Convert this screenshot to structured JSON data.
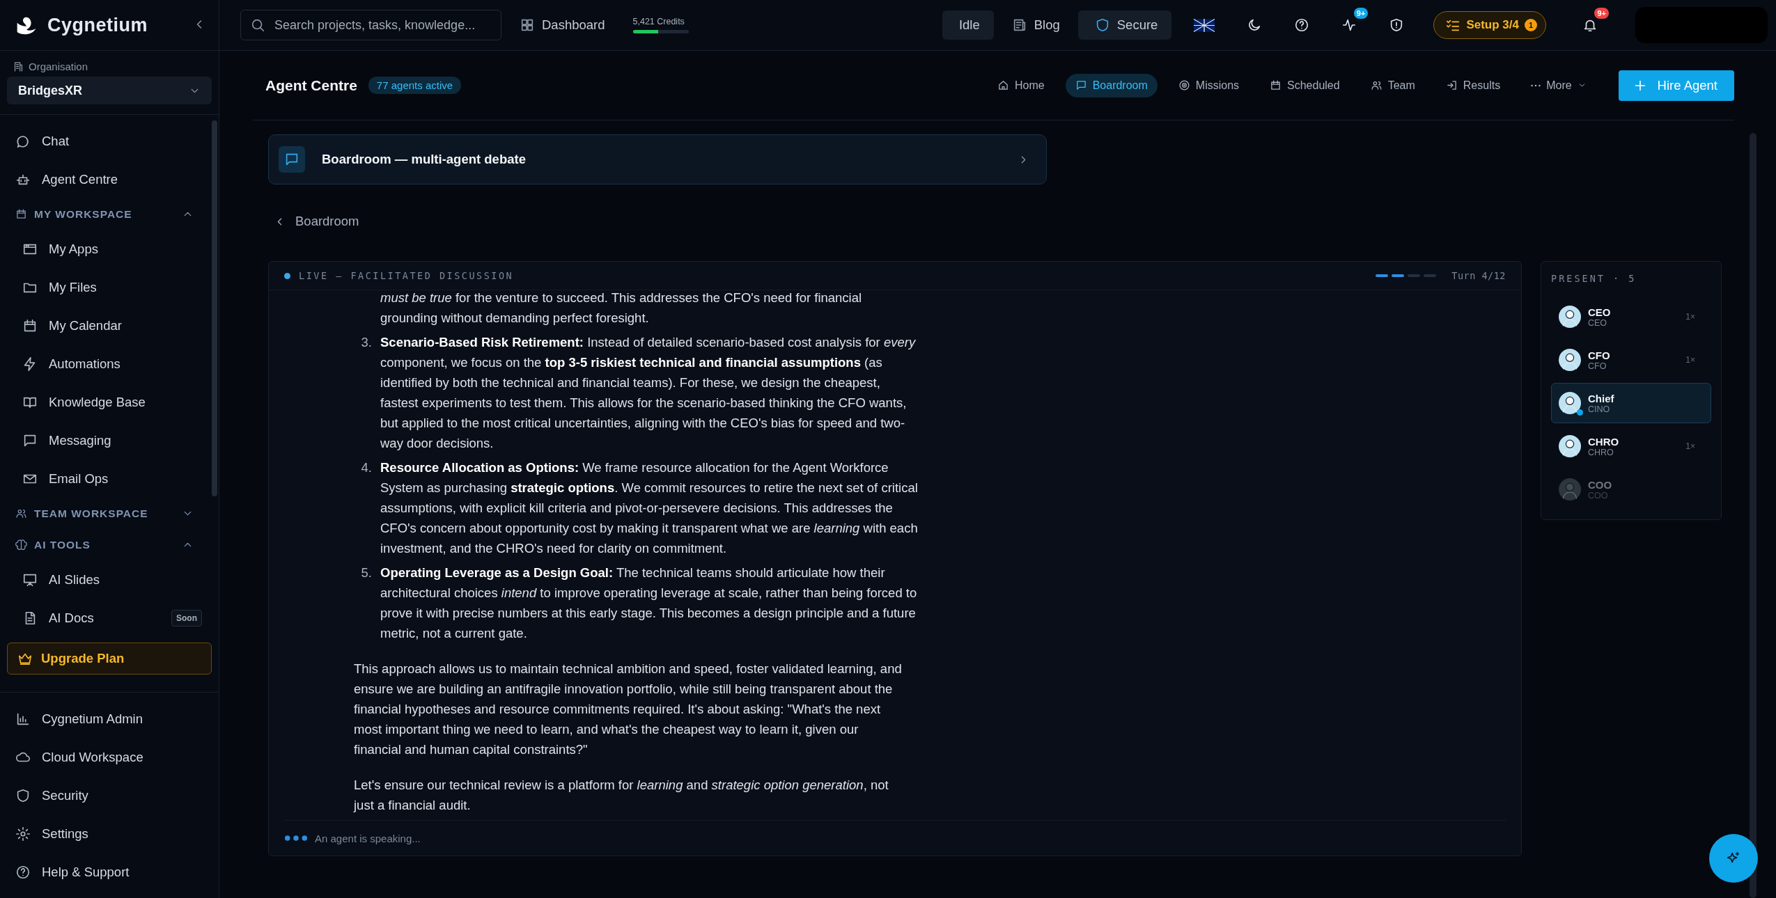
{
  "sidebar": {
    "brand": "Cygnetium",
    "organisation": {
      "label": "Organisation",
      "value": "BridgesXR"
    },
    "nav": [
      {
        "kind": "item",
        "label": "Chat"
      },
      {
        "kind": "item",
        "label": "Agent Centre"
      },
      {
        "kind": "section",
        "label": "MY WORKSPACE",
        "expanded": true,
        "children": [
          {
            "label": "My Apps"
          },
          {
            "label": "My Files"
          },
          {
            "label": "My Calendar"
          },
          {
            "label": "Automations"
          },
          {
            "label": "Knowledge Base"
          },
          {
            "label": "Messaging"
          },
          {
            "label": "Email Ops"
          }
        ]
      },
      {
        "kind": "section",
        "label": "TEAM WORKSPACE",
        "expanded": false
      },
      {
        "kind": "section",
        "label": "AI TOOLS",
        "expanded": true,
        "children": [
          {
            "label": "AI Slides"
          },
          {
            "label": "AI Docs",
            "badge": "Soon"
          }
        ]
      }
    ],
    "upgrade": "Upgrade Plan",
    "footer_items": [
      "Cygnetium Admin",
      "Cloud Workspace",
      "Security",
      "Settings",
      "Help & Support"
    ]
  },
  "top_bar": {
    "search": {
      "placeholder": "Search projects, tasks, knowledge..."
    },
    "dashboard": "Dashboard",
    "credits": {
      "label": "5,421 Credits",
      "level": 0.45
    },
    "status": "Idle",
    "blog": "Blog",
    "secure": "Secure",
    "activity_badge": "9+",
    "setup": {
      "label": "Setup 3/4",
      "badge": "1"
    },
    "notifications_badge": "9+"
  },
  "header": {
    "title": "Agent Centre",
    "badge": "77 agents active",
    "tabs": [
      {
        "label": "Home",
        "selected": false
      },
      {
        "label": "Boardroom",
        "selected": true
      },
      {
        "label": "Missions",
        "selected": false
      },
      {
        "label": "Scheduled",
        "selected": false
      },
      {
        "label": "Team",
        "selected": false
      },
      {
        "label": "Results",
        "selected": false
      },
      {
        "label": "More",
        "selected": false
      }
    ],
    "primary_button": "Hire Agent"
  },
  "banner": {
    "title": "Boardroom — multi-agent debate"
  },
  "back_link": "Boardroom",
  "discussion": {
    "status": "LIVE — FACILITATED DISCUSSION",
    "turn": "Turn 4/12",
    "progress_segments": [
      {
        "filled": true
      },
      {
        "filled": true
      },
      {
        "filled": false
      },
      {
        "filled": false
      }
    ],
    "list_items": [
      {
        "text": "*must be true* for the venture to succeed. This addresses the CFO's need for financial grounding without demanding perfect foresight."
      },
      {
        "number": "3.",
        "text": "**Scenario-Based Risk Retirement:** Instead of detailed scenario-based cost analysis for *every* component, we focus on the **top 3-5 riskiest technical and financial assumptions** (as identified by both the technical and financial teams). For these, we design the cheapest, fastest experiments to test them. This allows for the scenario-based thinking the CFO wants, but applied to the most critical uncertainties, aligning with the CEO's bias for speed and two-way door decisions."
      },
      {
        "number": "4.",
        "text": "**Resource Allocation as Options:** We frame resource allocation for the Agent Workforce System as purchasing **strategic options**. We commit resources to retire the next set of critical assumptions, with explicit kill criteria and pivot-or-persevere decisions. This addresses the CFO's concern about opportunity cost by making it transparent what we are *learning* with each investment, and the CHRO's need for clarity on commitment."
      },
      {
        "number": "5.",
        "text": "**Operating Leverage as a Design Goal:** The technical teams should articulate how their architectural choices *intend* to improve operating leverage at scale, rather than being forced to prove it with precise numbers at this early stage. This becomes a design principle and a future metric, not a current gate."
      }
    ],
    "paragraphs": [
      "This approach allows us to maintain technical ambition and speed, foster validated learning, and ensure we are building an antifragile innovation portfolio, while still being transparent about the financial hypotheses and resource commitments required. It's about asking: \"What's the next most important thing we need to learn, and what's the cheapest way to learn it, given our financial and human capital constraints?\"",
      "Let's ensure our technical review is a platform for *learning* and *strategic option generation*, not just a financial audit."
    ],
    "typing": "An agent is speaking..."
  },
  "present": {
    "title": "PRESENT · 5",
    "agents": [
      {
        "name": "CEO",
        "role": "CEO",
        "count": "1×",
        "selected": false,
        "speaking": false,
        "online": true
      },
      {
        "name": "CFO",
        "role": "CFO",
        "count": "1×",
        "selected": false,
        "speaking": false,
        "online": true
      },
      {
        "name": "Chief",
        "role": "CINO",
        "selected": true,
        "speaking": true,
        "online": true
      },
      {
        "name": "CHRO",
        "role": "CHRO",
        "count": "1×",
        "selected": false,
        "speaking": false,
        "online": true
      },
      {
        "name": "COO",
        "role": "COO",
        "selected": false,
        "speaking": false,
        "online": false
      }
    ]
  }
}
